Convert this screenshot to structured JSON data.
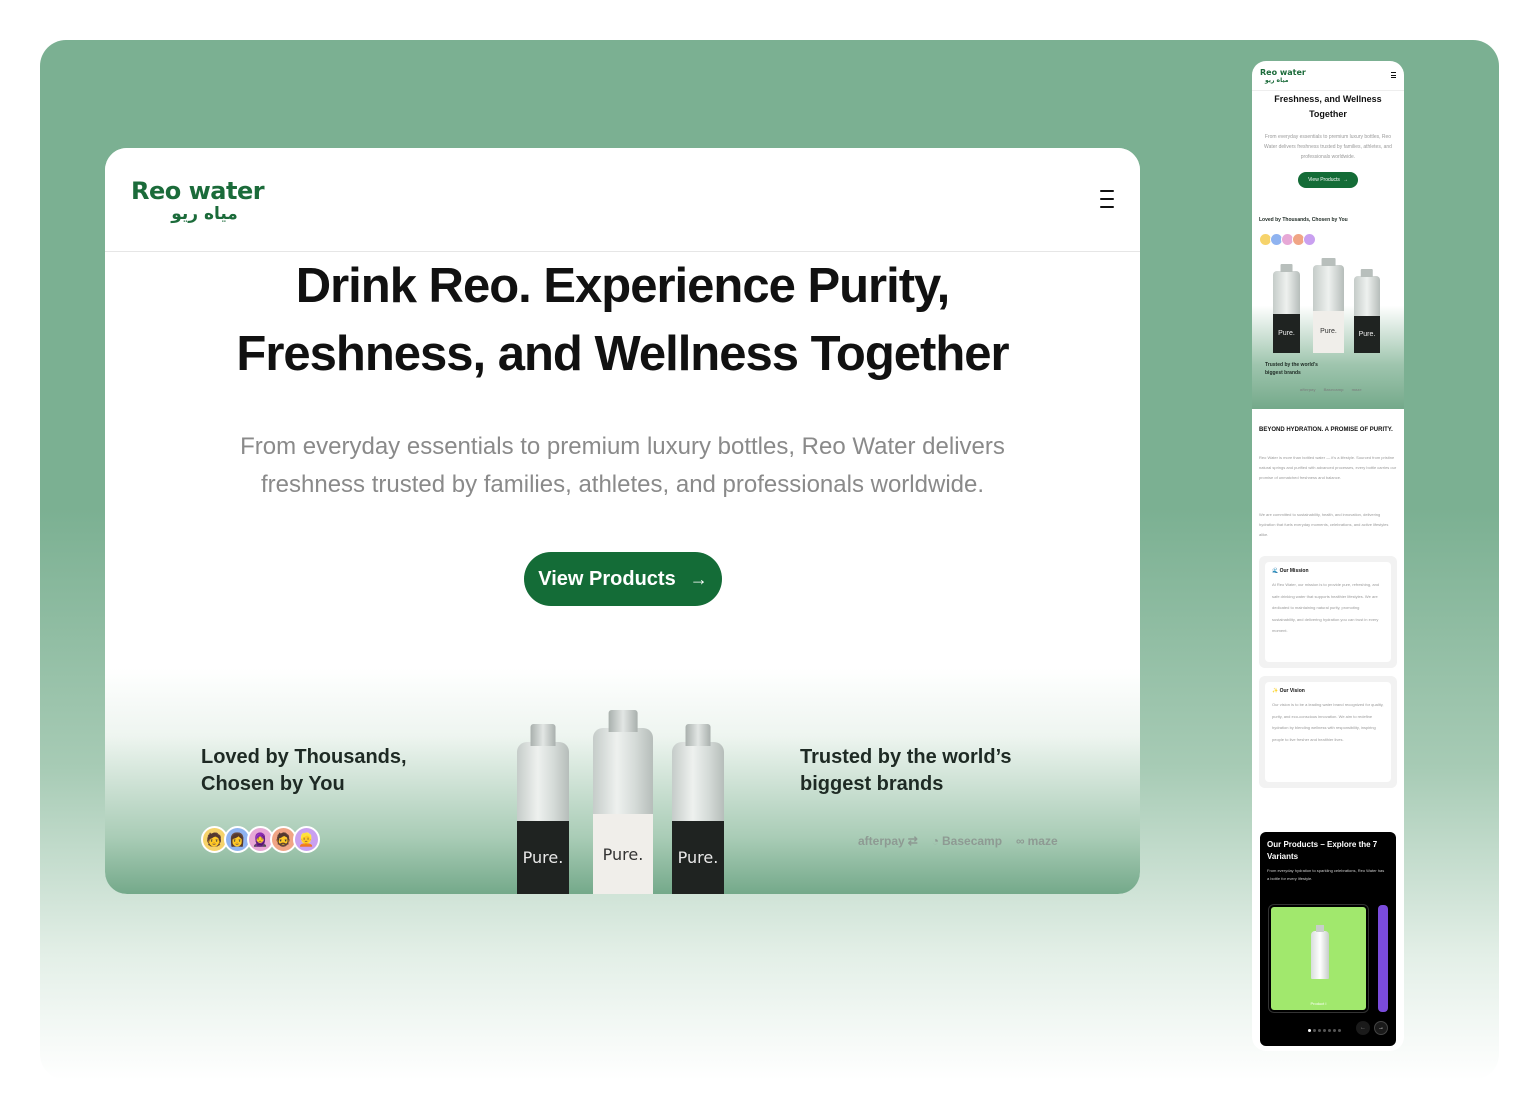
{
  "brand": {
    "name_en": "Reo water",
    "name_ar": "مياه ريو",
    "color": "#1b6b3a"
  },
  "desktop": {
    "hero": {
      "title_line1": "Drink Reo. Experience Purity,",
      "title_line2": "Freshness, and Wellness Together",
      "subtitle_line1": "From everyday essentials to premium luxury bottles, Reo Water delivers",
      "subtitle_line2": "freshness trusted by families, athletes, and professionals worldwide.",
      "cta_label": "View Products",
      "cta_icon": "arrow-right-icon"
    },
    "loved_line1": "Loved by Thousands,",
    "loved_line2": "Chosen by You",
    "trusted_line1": "Trusted by the world’s",
    "trusted_line2": "biggest brands",
    "bottle_label": "Pure.",
    "brands": [
      "afterpay",
      "Basecamp",
      "maze"
    ]
  },
  "mobile": {
    "title_line1": "Freshness, and Wellness",
    "title_line2": "Together",
    "subtitle": "From everyday essentials to premium luxury bottles, Reo Water delivers freshness trusted by families, athletes, and professionals worldwide.",
    "cta_label": "View Products",
    "loved": "Loved by Thousands, Chosen by You",
    "trusted_line1": "Trusted by the world’s",
    "trusted_line2": "biggest brands",
    "brands": [
      "afterpay",
      "Basecamp",
      "maze"
    ],
    "bottle_label": "Pure.",
    "beyond_title": "BEYOND HYDRATION. A PROMISE OF PURITY.",
    "beyond_p1": "Reo Water is more than bottled water — it’s a lifestyle. Sourced from pristine natural springs and purified with advanced processes, every bottle carries our promise of unmatched freshness and balance.",
    "beyond_p2": "We are committed to sustainability, health, and innovation, delivering hydration that fuels everyday moments, celebrations, and active lifestyles alike.",
    "mission_title": "🌊 Our Mission",
    "mission_body": "At Reo Water, our mission is to provide pure, refreshing, and safe drinking water that supports healthier lifestyles. We are dedicated to maintaining natural purity, promoting sustainability, and delivering hydration you can trust in every moment.",
    "vision_title": "✨ Our Vision",
    "vision_body": "Our vision is to be a leading water brand recognized for quality, purity, and eco-conscious innovation. We aim to redefine hydration by blending wellness with responsibility, inspiring people to live fresher and healthier lives.",
    "products_title": "Our Products – Explore the 7 Variants",
    "products_sub": "From everyday hydration to sparkling celebrations, Reo Water has a bottle for every lifestyle.",
    "product_card_label": "Product I",
    "product_card_color": "#a1e86d"
  }
}
